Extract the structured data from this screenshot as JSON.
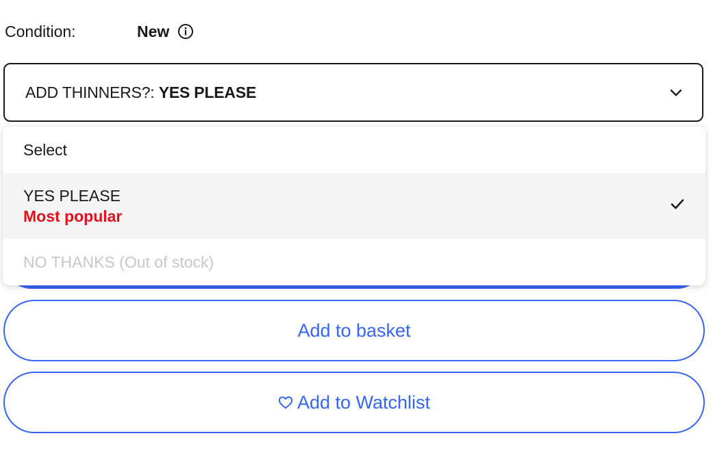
{
  "condition": {
    "label": "Condition:",
    "value": "New",
    "info_icon": "info-circle-icon"
  },
  "variation_select": {
    "label": "ADD THINNERS?:",
    "selected_value": "YES PLEASE",
    "chevron_icon": "chevron-down-icon",
    "expanded": true
  },
  "dropdown": {
    "options": [
      {
        "label": "Select",
        "selected": false,
        "disabled": false
      },
      {
        "label": "YES PLEASE",
        "tag": "Most popular",
        "selected": true,
        "disabled": false,
        "check_icon": "checkmark-icon"
      },
      {
        "label": "NO THANKS (Out of stock)",
        "selected": false,
        "disabled": true
      }
    ]
  },
  "buttons": {
    "add_to_basket": "Add to basket",
    "add_to_watchlist": "Add to Watchlist",
    "watchlist_icon": "heart-icon"
  },
  "colors": {
    "accent_blue": "#3665f3",
    "tag_red": "#e0101c",
    "disabled_text": "#c7c7c7",
    "text": "#191919"
  }
}
